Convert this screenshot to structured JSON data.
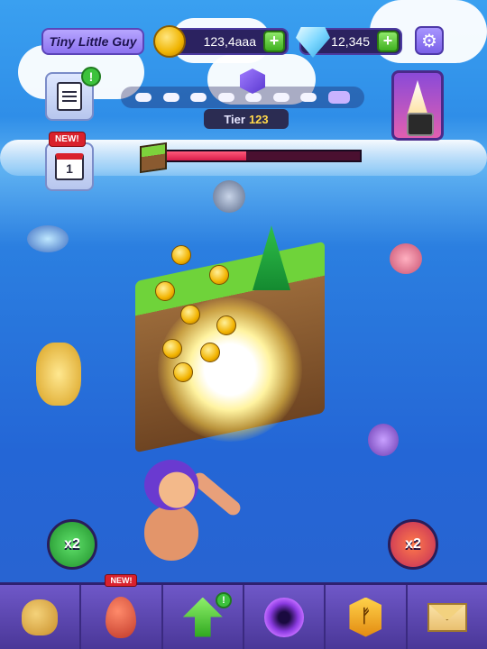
{
  "player": {
    "name": "Tiny Little Guy"
  },
  "resources": {
    "coins": "123,4aaa",
    "gems": "12,345",
    "coin_icon": "gold-coin-icon",
    "gem_icon": "diamond-icon",
    "plus_label": "+"
  },
  "settings": {
    "icon": "gear-icon",
    "glyph": "⚙"
  },
  "left_panel": {
    "quests": {
      "icon": "clipboard-icon",
      "badge": "!"
    },
    "daily": {
      "icon": "calendar-check-icon",
      "new_label": "NEW!",
      "day": "1"
    }
  },
  "tier": {
    "label": "Tier",
    "value": "123",
    "dots_total": 8,
    "current_index": 7
  },
  "boss_health": {
    "fill_fraction": 0.41
  },
  "boosts": {
    "left": {
      "label": "x2",
      "icon": "coin-boost-icon"
    },
    "right": {
      "label": "x2",
      "icon": "damage-boost-icon"
    }
  },
  "bottom_nav": [
    {
      "name": "bag",
      "icon": "coin-bag-icon"
    },
    {
      "name": "egg",
      "icon": "egg-icon",
      "new_label": "NEW!"
    },
    {
      "name": "upgrade",
      "icon": "upgrade-arrow-icon",
      "badge": "!"
    },
    {
      "name": "portal",
      "icon": "portal-icon"
    },
    {
      "name": "rune",
      "icon": "rune-icon",
      "glyph": "ᚠ"
    },
    {
      "name": "mail",
      "icon": "mail-icon"
    }
  ]
}
